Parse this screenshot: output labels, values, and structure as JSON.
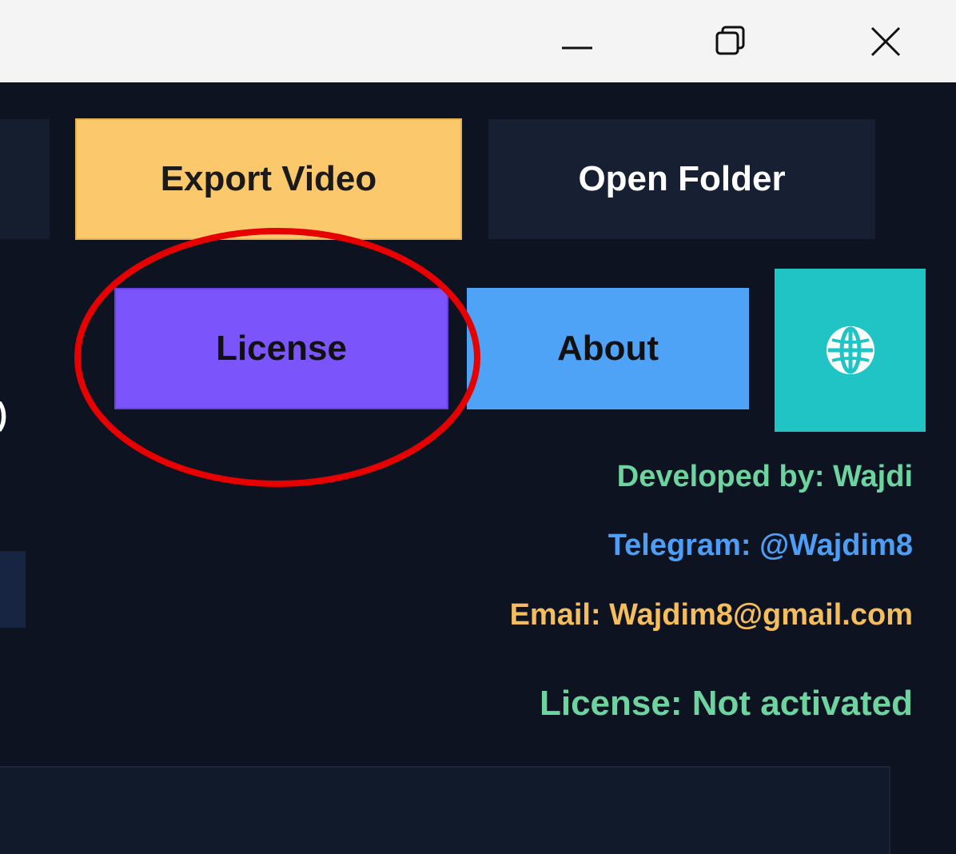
{
  "window": {
    "controls": {
      "minimize_icon": "minimize-icon",
      "maximize_icon": "restore-icon",
      "close_icon": "close-icon"
    }
  },
  "toolbar": {
    "export_video_label": "Export Video",
    "open_folder_label": "Open Folder",
    "license_label": "License",
    "about_label": "About",
    "language_icon": "globe-icon"
  },
  "partial_text": {
    "left_edge_glyph": ")"
  },
  "credits": {
    "developer": "Developed by: Wajdi",
    "telegram": "Telegram: @Wajdim8",
    "email": "Email: Wajdim8@gmail.com",
    "license_status": "License: Not activated"
  },
  "colors": {
    "export_video_bg": "#fbc96b",
    "open_folder_bg": "#172033",
    "license_bg": "#7b55fb",
    "about_bg": "#4ea3f7",
    "globe_bg": "#20c4c4",
    "developer_text": "#6dd4a0",
    "telegram_text": "#4e9ef5",
    "email_text": "#f5bd5c",
    "license_status_text": "#6dd4a0",
    "annotation_circle": "#e60000"
  }
}
